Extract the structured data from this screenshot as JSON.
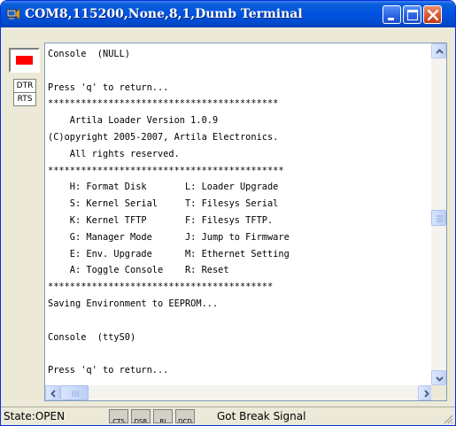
{
  "window": {
    "title": "COM8,115200,None,8,1,Dumb Terminal",
    "controls": {
      "minimize": "minimize-icon",
      "maximize": "maximize-icon",
      "close": "close-icon"
    },
    "accent": "#0053e1"
  },
  "signals": {
    "led_color": "#ff0000",
    "dtr_label": "DTR",
    "rts_label": "RTS"
  },
  "console": {
    "lines": [
      "Console  (NULL)",
      "",
      "Press 'q' to return...",
      "******************************************",
      "    Artila Loader Version 1.0.9",
      "(C)opyright 2005-2007, Artila Electronics.",
      "    All rights reserved.",
      "*******************************************",
      "    H: Format Disk       L: Loader Upgrade",
      "    S: Kernel Serial     T: Filesys Serial",
      "    K: Kernel TFTP       F: Filesys TFTP.",
      "    G: Manager Mode      J: Jump to Firmware",
      "    E: Env. Upgrade      M: Ethernet Setting",
      "    A: Toggle Console    R: Reset",
      "*****************************************",
      "Saving Environment to EEPROM...",
      "",
      "Console  (ttyS0)",
      "",
      "Press 'q' to return..."
    ]
  },
  "statusbar": {
    "state_label": "State:",
    "state_value": "OPEN",
    "indicators": [
      "CTS",
      "DSR",
      "RI",
      "DCD"
    ],
    "message": "Got Break Signal"
  }
}
